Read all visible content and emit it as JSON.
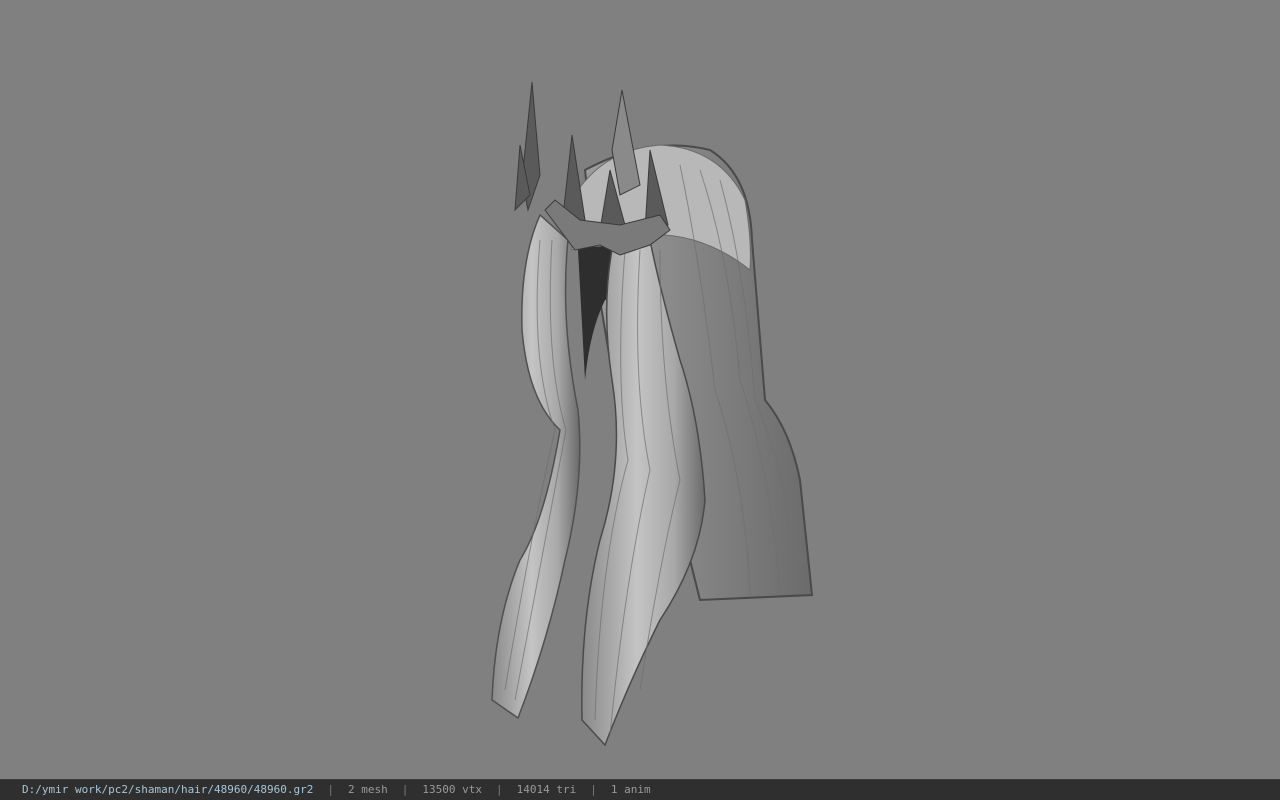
{
  "status": {
    "file_path": "D:/ymir work/pc2/shaman/hair/48960/48960.gr2",
    "separator": "|",
    "mesh_count": "2 mesh",
    "vertex_count": "13500 vtx",
    "triangle_count": "14014 tri",
    "anim_count": "1 anim"
  },
  "colors": {
    "viewport_bg": "#808080",
    "statusbar_bg": "#2f2f2f",
    "model_light": "#bdbdbd",
    "model_dark": "#3a3a3a"
  },
  "icons": {
    "model": "hair-mesh-icon"
  }
}
